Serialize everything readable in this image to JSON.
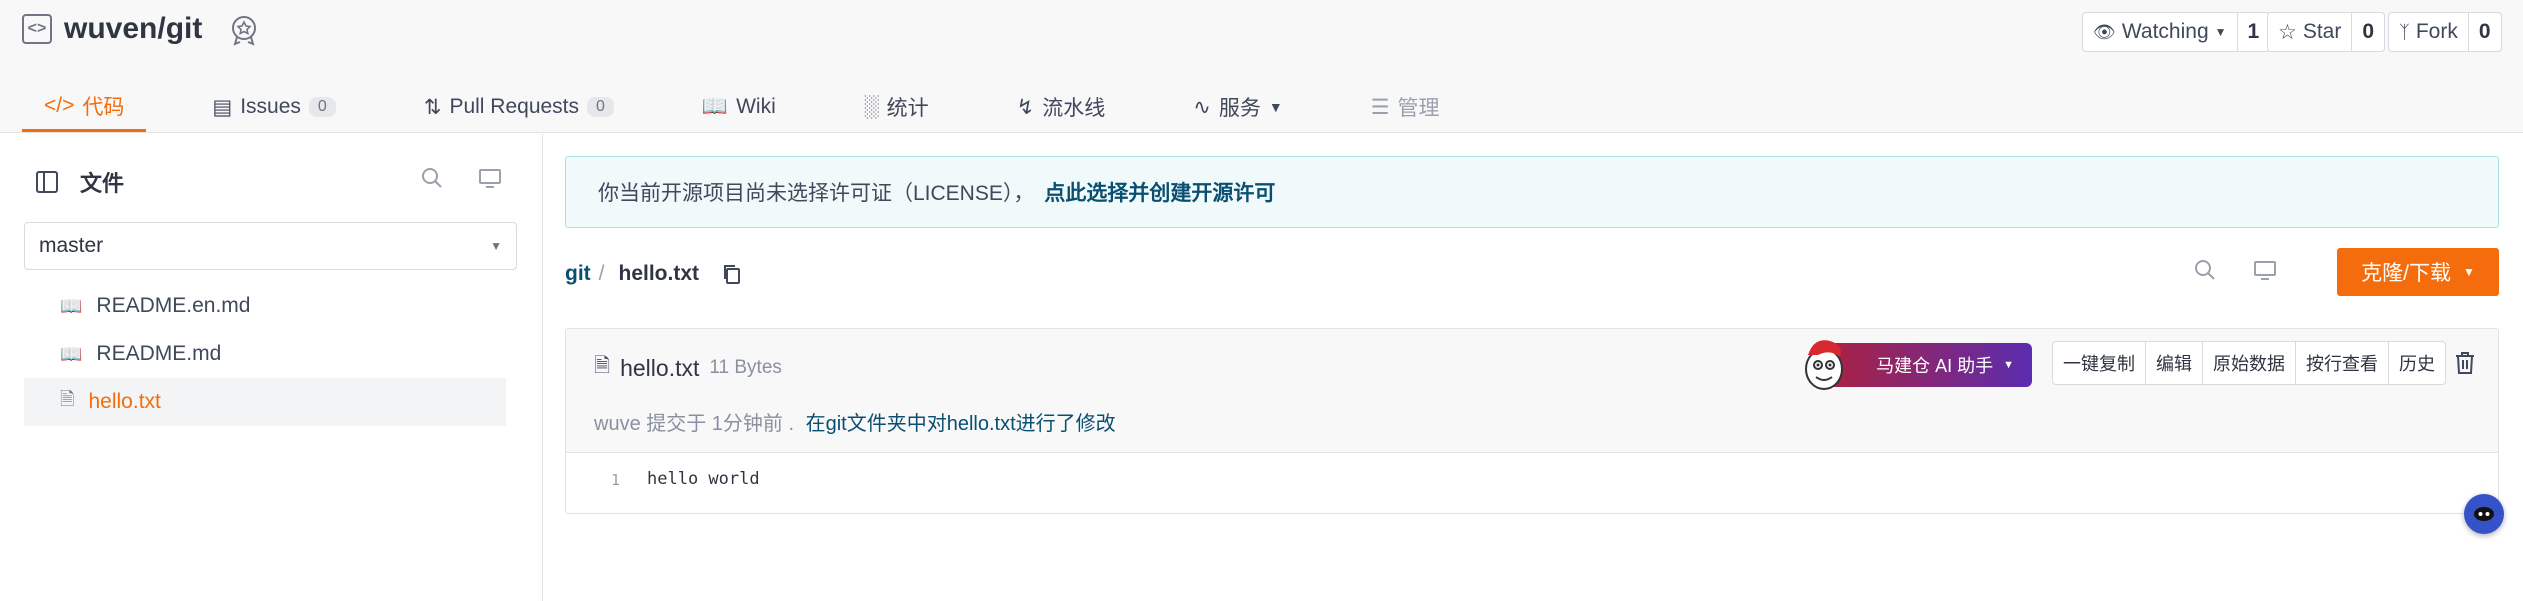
{
  "repo": {
    "title": "wuven/git"
  },
  "stats": {
    "watching_label": "Watching",
    "watching_count": "1",
    "star_label": "Star",
    "star_count": "0",
    "fork_label": "Fork",
    "fork_count": "0"
  },
  "tabs": [
    {
      "label": "代码"
    },
    {
      "label": "Issues",
      "count": "0"
    },
    {
      "label": "Pull Requests",
      "count": "0"
    },
    {
      "label": "Wiki"
    },
    {
      "label": "统计"
    },
    {
      "label": "流水线"
    },
    {
      "label": "服务"
    },
    {
      "label": "管理"
    }
  ],
  "sidebar": {
    "title": "文件",
    "branch": "master",
    "files": [
      {
        "name": "README.en.md"
      },
      {
        "name": "README.md"
      },
      {
        "name": "hello.txt"
      }
    ]
  },
  "notice": {
    "text": "你当前开源项目尚未选择许可证（LICENSE），",
    "link": "点此选择并创建开源许可"
  },
  "breadcrumb": {
    "repo": "git",
    "sep": "/",
    "file": "hello.txt"
  },
  "clone_button": "克隆/下载",
  "file": {
    "name": "hello.txt",
    "size": "11 Bytes",
    "commit_meta": "wuve 提交于 1分钟前 .",
    "commit_message": "在git文件夹中对hello.txt进行了修改",
    "ai_button": "马建仓 AI 助手",
    "actions": [
      "一键复制",
      "编辑",
      "原始数据",
      "按行查看",
      "历史"
    ],
    "lines": [
      {
        "number": "1",
        "text": "hello world"
      }
    ]
  },
  "colors": {
    "accent": "#f56c0c",
    "link": "#0a4f72"
  }
}
